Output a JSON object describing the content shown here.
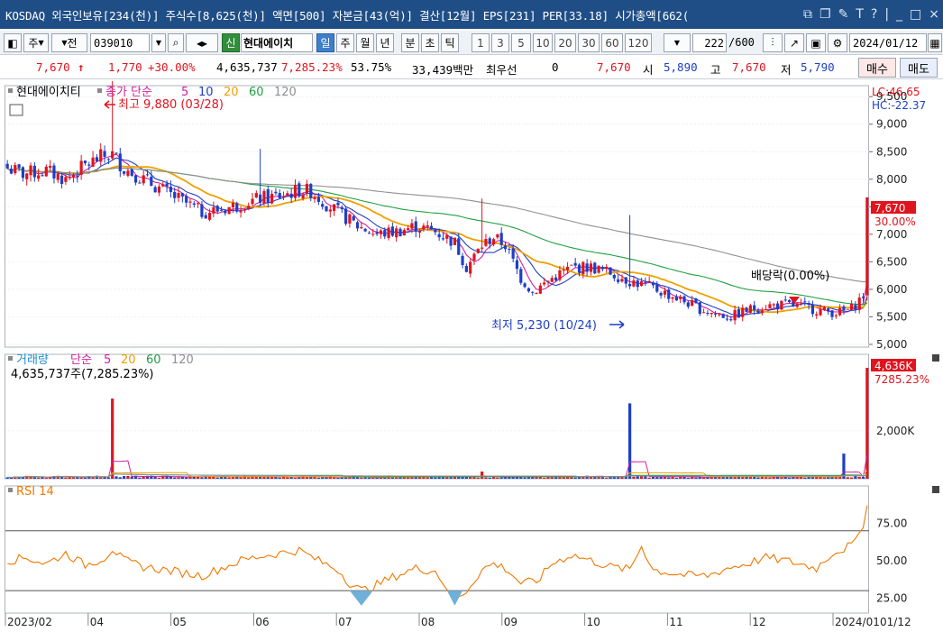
{
  "titlebar": {
    "text": "KOSDAQ 외국인보유[234(천)] 주식수[8,625(천)] 액면[500] 자본금[43(억)] 결산[12월] EPS[231] PER[33.18] 시가총액[662(",
    "icons": [
      "window-icon",
      "copy-window-icon",
      "chart-tool-icon",
      "text-icon",
      "help-icon",
      "minimize-icon",
      "maximize-icon",
      "close-icon"
    ]
  },
  "toolbar": {
    "market": "주",
    "price_type": "전",
    "code": "039010",
    "name_badge": "신",
    "name": "현대에이치",
    "periods": [
      "일",
      "주",
      "월",
      "년",
      "분",
      "초",
      "틱"
    ],
    "active_period": "일",
    "intervals": [
      "1",
      "3",
      "5",
      "10",
      "20",
      "30",
      "60",
      "120"
    ],
    "count": "222",
    "total": "/600",
    "date": "2024/01/12"
  },
  "quote": {
    "price": "7,670",
    "arrow": "↑",
    "change": "1,770",
    "change_pct": "+30.00%",
    "volume": "4,635,737",
    "vol_ratio": "7,285.23%",
    "turnover": "53.75%",
    "amount": "33,439백만",
    "pref_label": "최우선",
    "pref_value": "0",
    "bid": "7,670",
    "open_label": "시",
    "open": "5,890",
    "high_label": "고",
    "high": "7,670",
    "low_label": "저",
    "low": "5,790",
    "buy": "매수",
    "sell": "매도"
  },
  "chart_data": [
    {
      "type": "candlestick",
      "name": "price",
      "legend": {
        "stock": "현대에이치티",
        "ma_label": "종가 단순",
        "ma_periods": [
          "5",
          "10",
          "20",
          "60",
          "120"
        ]
      },
      "annotations": {
        "high": "최고 9,880 (03/28)",
        "low": "최저 5,230 (10/24)",
        "dividend": "배당락(0.00%)"
      },
      "yaxis_ticks": [
        "9,500",
        "9,000",
        "8,500",
        "8,000",
        "7,500",
        "7,000",
        "6,500",
        "6,000",
        "5,500",
        "5,000"
      ],
      "ylim": [
        4950,
        9700
      ],
      "last_tag": {
        "price": "7,670",
        "pct": "30.00%"
      },
      "corner": {
        "lc": "LC:46.65",
        "hc": "HC:-22.37"
      },
      "x_dates": [
        "2023/02",
        "04",
        "05",
        "06",
        "07",
        "08",
        "09",
        "10",
        "11",
        "12",
        "2024/01"
      ],
      "x_right": "01/12",
      "anchors": [
        [
          0,
          8200
        ],
        [
          4,
          8100
        ],
        [
          10,
          8150
        ],
        [
          15,
          8000
        ],
        [
          20,
          8250
        ],
        [
          24,
          8400
        ],
        [
          27,
          8450
        ],
        [
          30,
          8200
        ],
        [
          35,
          8000
        ],
        [
          40,
          7800
        ],
        [
          45,
          7600
        ],
        [
          50,
          7400
        ],
        [
          55,
          7450
        ],
        [
          60,
          7550
        ],
        [
          65,
          7650
        ],
        [
          70,
          7700
        ],
        [
          75,
          7800
        ],
        [
          78,
          7780
        ],
        [
          82,
          7550
        ],
        [
          86,
          7350
        ],
        [
          90,
          7150
        ],
        [
          95,
          7000
        ],
        [
          100,
          7050
        ],
        [
          105,
          7150
        ],
        [
          110,
          7050
        ],
        [
          115,
          6850
        ],
        [
          118,
          6400
        ],
        [
          122,
          6800
        ],
        [
          125,
          6950
        ],
        [
          128,
          6800
        ],
        [
          132,
          6200
        ],
        [
          135,
          5950
        ],
        [
          140,
          6200
        ],
        [
          145,
          6400
        ],
        [
          150,
          6400
        ],
        [
          155,
          6300
        ],
        [
          160,
          6150
        ],
        [
          165,
          6050
        ],
        [
          170,
          5900
        ],
        [
          175,
          5750
        ],
        [
          178,
          5650
        ],
        [
          182,
          5550
        ],
        [
          186,
          5500
        ],
        [
          190,
          5620
        ],
        [
          195,
          5700
        ],
        [
          200,
          5720
        ],
        [
          205,
          5680
        ],
        [
          210,
          5600
        ],
        [
          214,
          5580
        ],
        [
          217,
          5650
        ],
        [
          220,
          5890
        ],
        [
          221,
          5900
        ]
      ],
      "last_candle": {
        "open": 5890,
        "high": 7670,
        "low": 5790,
        "close": 7670
      },
      "spikes": [
        [
          27,
          9880
        ],
        [
          65,
          8550
        ],
        [
          122,
          7650
        ],
        [
          160,
          7350
        ]
      ]
    },
    {
      "type": "bar",
      "name": "volume",
      "legend": {
        "label": "거래량",
        "ma_label": "단순",
        "ma_periods": [
          "5",
          "20",
          "60",
          "120"
        ]
      },
      "label": "4,635,737주(7,285.23%)",
      "yaxis_ticks": [
        "2,000K"
      ],
      "ylim": [
        0,
        5200
      ],
      "last_tag": {
        "value": "4,636K",
        "pct": "7285.23%"
      },
      "spikes": [
        [
          27,
          3350
        ],
        [
          122,
          300
        ],
        [
          160,
          3150
        ],
        [
          215,
          1050
        ],
        [
          221,
          4636
        ]
      ]
    },
    {
      "type": "line",
      "name": "rsi",
      "legend": {
        "label": "RSI 14"
      },
      "yaxis_ticks": [
        "75.00",
        "50.00",
        "25.00"
      ],
      "ylim": [
        15,
        100
      ],
      "levels": [
        70,
        30
      ],
      "anchors": [
        [
          0,
          50
        ],
        [
          5,
          52
        ],
        [
          10,
          48
        ],
        [
          15,
          55
        ],
        [
          20,
          47
        ],
        [
          25,
          52
        ],
        [
          27,
          58
        ],
        [
          30,
          50
        ],
        [
          35,
          46
        ],
        [
          40,
          44
        ],
        [
          45,
          42
        ],
        [
          50,
          40
        ],
        [
          55,
          45
        ],
        [
          60,
          50
        ],
        [
          65,
          53
        ],
        [
          70,
          55
        ],
        [
          75,
          57
        ],
        [
          80,
          50
        ],
        [
          85,
          44
        ],
        [
          88,
          35
        ],
        [
          91,
          30
        ],
        [
          95,
          34
        ],
        [
          100,
          40
        ],
        [
          105,
          45
        ],
        [
          110,
          43
        ],
        [
          113,
          32
        ],
        [
          115,
          22
        ],
        [
          118,
          30
        ],
        [
          122,
          44
        ],
        [
          125,
          48
        ],
        [
          128,
          45
        ],
        [
          132,
          35
        ],
        [
          136,
          36
        ],
        [
          140,
          48
        ],
        [
          145,
          54
        ],
        [
          150,
          50
        ],
        [
          155,
          46
        ],
        [
          160,
          44
        ],
        [
          163,
          60
        ],
        [
          166,
          44
        ],
        [
          170,
          42
        ],
        [
          175,
          40
        ],
        [
          180,
          40
        ],
        [
          185,
          45
        ],
        [
          190,
          48
        ],
        [
          195,
          52
        ],
        [
          200,
          50
        ],
        [
          205,
          47
        ],
        [
          208,
          45
        ],
        [
          212,
          55
        ],
        [
          215,
          58
        ],
        [
          218,
          62
        ],
        [
          220,
          75
        ],
        [
          221,
          89
        ]
      ]
    }
  ]
}
